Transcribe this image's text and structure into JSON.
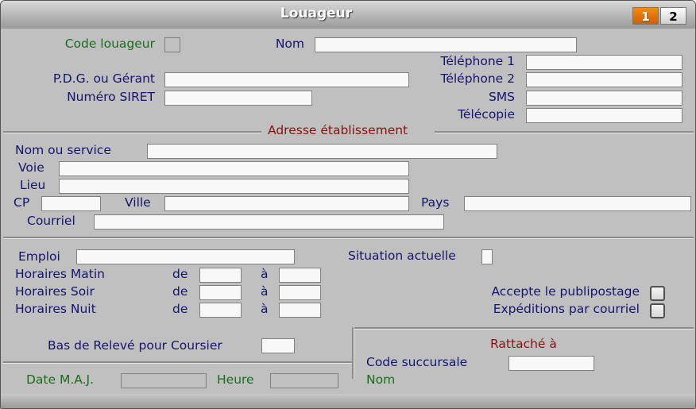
{
  "window": {
    "title": "Louageur",
    "pages": [
      {
        "label": "1",
        "active": true,
        "color": "#e87000"
      },
      {
        "label": "2",
        "active": false
      }
    ]
  },
  "identity": {
    "code_label": "Code louageur",
    "code_value": "",
    "nom_label": "Nom",
    "nom_value": "",
    "pdg_label": "P.D.G. ou Gérant",
    "pdg_value": "",
    "siret_label": "Numéro SIRET",
    "siret_value": "",
    "tel1_label": "Téléphone 1",
    "tel1_value": "",
    "tel2_label": "Téléphone 2",
    "tel2_value": "",
    "sms_label": "SMS",
    "sms_value": "",
    "fax_label": "Télécopie",
    "fax_value": ""
  },
  "address": {
    "section_title": "Adresse établissement",
    "service_label": "Nom ou service",
    "service_value": "",
    "voie_label": "Voie",
    "voie_value": "",
    "lieu_label": "Lieu",
    "lieu_value": "",
    "cp_label": "CP",
    "cp_value": "",
    "ville_label": "Ville",
    "ville_value": "",
    "pays_label": "Pays",
    "pays_value": "",
    "courriel_label": "Courriel",
    "courriel_value": ""
  },
  "work": {
    "emploi_label": "Emploi",
    "emploi_value": "",
    "situation_label": "Situation actuelle",
    "situation_value": "",
    "de_label": "de",
    "a_label": "à",
    "hours": [
      {
        "label": "Horaires Matin",
        "from": "",
        "to": ""
      },
      {
        "label": "Horaires Soir",
        "from": "",
        "to": ""
      },
      {
        "label": "Horaires Nuit",
        "from": "",
        "to": ""
      }
    ],
    "publipostage_label": "Accepte le publipostage",
    "publipostage_checked": false,
    "expeditions_label": "Expéditions par courriel",
    "expeditions_checked": false,
    "bas_releve_label": "Bas de Relevé pour Coursier",
    "bas_releve_value": ""
  },
  "meta": {
    "date_label": "Date M.A.J.",
    "date_value": "",
    "heure_label": "Heure",
    "heure_value": ""
  },
  "rattache": {
    "title": "Rattaché à",
    "code_label": "Code succursale",
    "code_value": "",
    "nom_label": "Nom",
    "nom_value": ""
  }
}
